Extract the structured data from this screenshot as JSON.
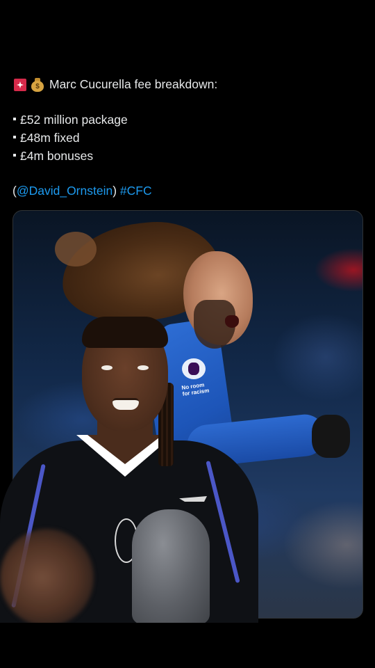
{
  "post": {
    "headline": "Marc Cucurella fee breakdown:",
    "leading_icons": [
      "siren-icon",
      "moneybag-icon"
    ],
    "moneybag_symbol": "$",
    "bullets": [
      "£52 million package",
      "£48m fixed",
      "£4m bonuses"
    ],
    "source_open": "(",
    "source_handle": "@David_Ornstein",
    "source_close": ")",
    "hashtag": "#CFC",
    "link_color": "#1d9bf0",
    "text_color": "#e7e9ea"
  },
  "media": {
    "sleeve_text": "No room for racism",
    "background_color": "#000000"
  }
}
